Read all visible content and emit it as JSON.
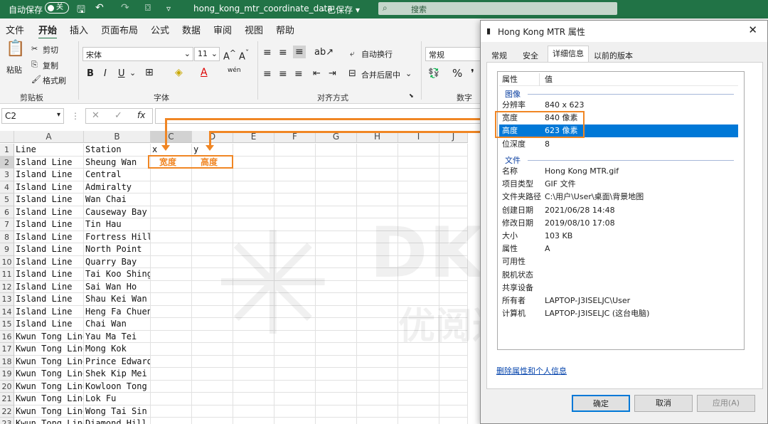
{
  "titlebar": {
    "autosave": "自动保存",
    "toggle": "关",
    "file_title": "hong_kong_mtr_coordinate_data",
    "save_state": "已保存",
    "search_placeholder": "搜索"
  },
  "menu": {
    "items": [
      "文件",
      "开始",
      "插入",
      "页面布局",
      "公式",
      "数据",
      "审阅",
      "视图",
      "帮助"
    ]
  },
  "ribbon": {
    "paste": "粘贴",
    "cut": "剪切",
    "copy": "复制",
    "format_painter": "格式刷",
    "clipboard": "剪贴板",
    "font_name": "宋体",
    "font_size": "11",
    "font": "字体",
    "wrap": "自动换行",
    "merge": "合并后居中",
    "alignment": "对齐方式",
    "number_format": "常规",
    "number": "数字",
    "bold": "B",
    "italic": "I",
    "underline": "U",
    "increase_font": "A^",
    "decrease_font": "A˅",
    "percent": "%",
    "wen": "wén"
  },
  "formula_bar": {
    "name_box": "C2",
    "fx": "fx",
    "cancel": "✕",
    "confirm": "✓"
  },
  "grid": {
    "columns": [
      "A",
      "B",
      "C",
      "D",
      "E",
      "F",
      "G",
      "H",
      "I",
      "J"
    ],
    "rows": [
      {
        "n": "1",
        "a": "Line",
        "b": "Station",
        "c": "x",
        "d": "y"
      },
      {
        "n": "2",
        "a": "Island Line",
        "b": "Sheung Wan",
        "c": "宽度",
        "d": "高度"
      },
      {
        "n": "3",
        "a": "Island Line",
        "b": "Central",
        "c": "",
        "d": ""
      },
      {
        "n": "4",
        "a": "Island Line",
        "b": "Admiralty",
        "c": "",
        "d": ""
      },
      {
        "n": "5",
        "a": "Island Line",
        "b": "Wan Chai",
        "c": "",
        "d": ""
      },
      {
        "n": "6",
        "a": "Island Line",
        "b": "Causeway Bay",
        "c": "",
        "d": ""
      },
      {
        "n": "7",
        "a": "Island Line",
        "b": "Tin Hau",
        "c": "",
        "d": ""
      },
      {
        "n": "8",
        "a": "Island Line",
        "b": "Fortress Hill",
        "c": "",
        "d": ""
      },
      {
        "n": "9",
        "a": "Island Line",
        "b": "North Point",
        "c": "",
        "d": ""
      },
      {
        "n": "10",
        "a": "Island Line",
        "b": "Quarry Bay",
        "c": "",
        "d": ""
      },
      {
        "n": "11",
        "a": "Island Line",
        "b": "Tai Koo Shing",
        "c": "",
        "d": ""
      },
      {
        "n": "12",
        "a": "Island Line",
        "b": "Sai Wan Ho",
        "c": "",
        "d": ""
      },
      {
        "n": "13",
        "a": "Island Line",
        "b": "Shau Kei Wan",
        "c": "",
        "d": ""
      },
      {
        "n": "14",
        "a": "Island Line",
        "b": "Heng Fa Chuen",
        "c": "",
        "d": ""
      },
      {
        "n": "15",
        "a": "Island Line",
        "b": "Chai Wan",
        "c": "",
        "d": ""
      },
      {
        "n": "16",
        "a": "Kwun Tong Line",
        "b": "Yau Ma Tei",
        "c": "",
        "d": ""
      },
      {
        "n": "17",
        "a": "Kwun Tong Line",
        "b": "Mong Kok",
        "c": "",
        "d": ""
      },
      {
        "n": "18",
        "a": "Kwun Tong Line",
        "b": "Prince Edward",
        "c": "",
        "d": ""
      },
      {
        "n": "19",
        "a": "Kwun Tong Line",
        "b": "Shek Kip Mei",
        "c": "",
        "d": ""
      },
      {
        "n": "20",
        "a": "Kwun Tong Line",
        "b": "Kowloon Tong",
        "c": "",
        "d": ""
      },
      {
        "n": "21",
        "a": "Kwun Tong Line",
        "b": "Lok Fu",
        "c": "",
        "d": ""
      },
      {
        "n": "22",
        "a": "Kwun Tong Line",
        "b": "Wong Tai Sin",
        "c": "",
        "d": ""
      },
      {
        "n": "23",
        "a": "Kwun Tong Line",
        "b": "Diamond Hill",
        "c": "",
        "d": ""
      }
    ]
  },
  "watermark": {
    "logo": "DKV eco",
    "slogan": "优阅达 大数据生态"
  },
  "dialog": {
    "title": "Hong Kong MTR 属性",
    "tabs": [
      "常规",
      "安全",
      "详细信息",
      "以前的版本"
    ],
    "header": {
      "key": "属性",
      "value": "值"
    },
    "sections": {
      "image": "图像",
      "file": "文件"
    },
    "image_props": [
      {
        "k": "分辨率",
        "v": "840 x 623"
      },
      {
        "k": "宽度",
        "v": "840 像素"
      },
      {
        "k": "高度",
        "v": "623 像素"
      },
      {
        "k": "位深度",
        "v": "8"
      }
    ],
    "file_props": [
      {
        "k": "名称",
        "v": "Hong Kong MTR.gif"
      },
      {
        "k": "项目类型",
        "v": "GIF 文件"
      },
      {
        "k": "文件夹路径",
        "v": "C:\\用户\\User\\桌面\\背景地图"
      },
      {
        "k": "创建日期",
        "v": "2021/06/28 14:48"
      },
      {
        "k": "修改日期",
        "v": "2019/08/10 17:08"
      },
      {
        "k": "大小",
        "v": "103 KB"
      },
      {
        "k": "属性",
        "v": "A"
      },
      {
        "k": "可用性",
        "v": ""
      },
      {
        "k": "脱机状态",
        "v": ""
      },
      {
        "k": "共享设备",
        "v": ""
      },
      {
        "k": "所有者",
        "v": "LAPTOP-J3ISELJC\\User"
      },
      {
        "k": "计算机",
        "v": "LAPTOP-J3ISELJC (这台电脑)"
      }
    ],
    "remove_link": "删除属性和个人信息",
    "ok": "确定",
    "cancel": "取消",
    "apply": "应用(A)"
  },
  "colors": {
    "excel_green": "#217346",
    "highlight": "#0078d7",
    "annotation": "#f08624"
  }
}
